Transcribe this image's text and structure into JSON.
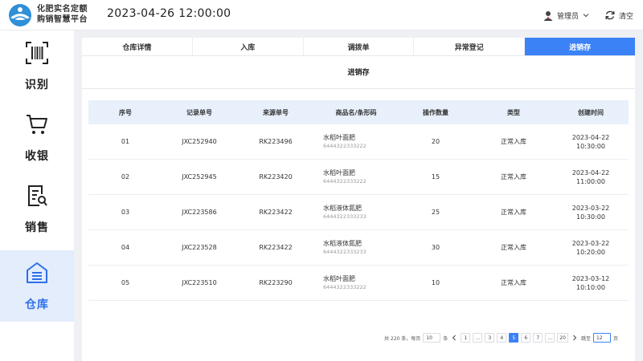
{
  "header": {
    "brand_line1": "化肥实名定额",
    "brand_line2": "购销智慧平台",
    "datetime": "2023-04-26  12:00:00",
    "user_label": "管理员",
    "clear_label": "清空"
  },
  "sidebar": {
    "items": [
      {
        "label": "识别",
        "icon": "scan-icon"
      },
      {
        "label": "收银",
        "icon": "cart-icon"
      },
      {
        "label": "销售",
        "icon": "sales-doc-icon"
      },
      {
        "label": "仓库",
        "icon": "warehouse-icon",
        "active": true
      }
    ]
  },
  "tabs": [
    "仓库详情",
    "入库",
    "调拨单",
    "异常登记",
    "进销存"
  ],
  "active_tab": "进销存",
  "section_title": "进销存",
  "table": {
    "headers": [
      "序号",
      "记录单号",
      "来源单号",
      "商品名/条形码",
      "操作数量",
      "类型",
      "创建时间"
    ],
    "rows": [
      {
        "no": "01",
        "record": "JXC252940",
        "source": "RK223496",
        "product": "水稻叶面肥",
        "barcode": "6444322333222",
        "qty": "20",
        "type": "正常入库",
        "date": "2023-04-22",
        "time": "10:30:00"
      },
      {
        "no": "02",
        "record": "JXC252945",
        "source": "RK223420",
        "product": "水稻叶面肥",
        "barcode": "6444322333222",
        "qty": "15",
        "type": "正常入库",
        "date": "2023-04-22",
        "time": "11:00:00"
      },
      {
        "no": "03",
        "record": "JXC223586",
        "source": "RK223422",
        "product": "水稻液体氮肥",
        "barcode": "6444322333233",
        "qty": "25",
        "type": "正常入库",
        "date": "2023-03-22",
        "time": "10:30:00"
      },
      {
        "no": "04",
        "record": "JXC223528",
        "source": "RK223422",
        "product": "水稻液体氮肥",
        "barcode": "6444322333233",
        "qty": "30",
        "type": "正常入库",
        "date": "2023-03-22",
        "time": "10:20:00"
      },
      {
        "no": "05",
        "record": "JXC223510",
        "source": "RK223290",
        "product": "水稻叶面肥",
        "barcode": "6444322333222",
        "qty": "10",
        "type": "正常入库",
        "date": "2023-03-12",
        "time": "10:10:00"
      }
    ]
  },
  "pagination": {
    "total_text": "共 220 条，每页",
    "page_size": "10",
    "page_size_unit": "条",
    "pages": [
      "1",
      "...",
      "3",
      "4",
      "5",
      "6",
      "7",
      "...",
      "20"
    ],
    "current_page": "5",
    "jump_label": "跳至",
    "jump_value": "12",
    "jump_unit": "页"
  },
  "colors": {
    "accent": "#3b82f6",
    "sidebar_active_bg": "#e3edfc",
    "table_header_bg": "#e8f0fb"
  }
}
